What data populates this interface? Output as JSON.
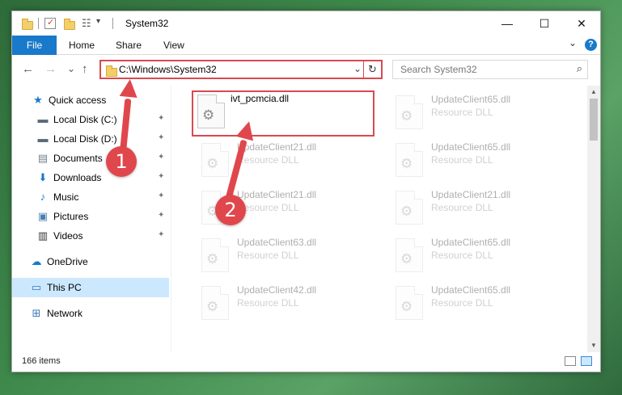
{
  "window": {
    "title": "System32",
    "controls": {
      "minimize": "—",
      "maximize": "☐",
      "close": "✕"
    }
  },
  "ribbon": {
    "tabs": [
      "File",
      "Home",
      "Share",
      "View"
    ],
    "expand_glyph": "⌄",
    "help_glyph": "?"
  },
  "nav": {
    "back": "←",
    "forward": "→",
    "recent": "⌄",
    "up": "↑",
    "address": "C:\\Windows\\System32",
    "address_dropdown": "⌄",
    "refresh": "↻",
    "search_placeholder": "Search System32",
    "search_glyph": "⌕"
  },
  "sidebar": {
    "items": [
      {
        "label": "Quick access",
        "icon": "star-icon",
        "glyph": "★",
        "color": "#1979ca",
        "pinned": false
      },
      {
        "label": "Local Disk (C:)",
        "icon": "drive-icon",
        "glyph": "▬",
        "color": "#5a6a7a",
        "pinned": true
      },
      {
        "label": "Local Disk (D:)",
        "icon": "drive-icon",
        "glyph": "▬",
        "color": "#5a6a7a",
        "pinned": true
      },
      {
        "label": "Documents",
        "icon": "documents-icon",
        "glyph": "▤",
        "color": "#6f7f8f",
        "pinned": true
      },
      {
        "label": "Downloads",
        "icon": "downloads-icon",
        "glyph": "⬇",
        "color": "#1979ca",
        "pinned": true
      },
      {
        "label": "Music",
        "icon": "music-icon",
        "glyph": "♪",
        "color": "#1979ca",
        "pinned": true
      },
      {
        "label": "Pictures",
        "icon": "pictures-icon",
        "glyph": "▣",
        "color": "#4a7fb0",
        "pinned": true
      },
      {
        "label": "Videos",
        "icon": "videos-icon",
        "glyph": "▥",
        "color": "#333333",
        "pinned": true
      },
      {
        "label": "OneDrive",
        "icon": "cloud-icon",
        "glyph": "☁",
        "color": "#1979ca",
        "pinned": false
      },
      {
        "label": "This PC",
        "icon": "computer-icon",
        "glyph": "▭",
        "color": "#3a78b8",
        "pinned": false
      },
      {
        "label": "Network",
        "icon": "network-icon",
        "glyph": "⊞",
        "color": "#3a78b8",
        "pinned": false
      }
    ],
    "pin_glyph": "📌"
  },
  "files": [
    {
      "name": "ivt_pcmcia.dll",
      "type": "",
      "faded": false,
      "highlight": true
    },
    {
      "name": "UpdateClient65.dll",
      "type": "Resource DLL",
      "faded": true
    },
    {
      "name": "UpdateClient21.dll",
      "type": "Resource DLL",
      "faded": true
    },
    {
      "name": "UpdateClient65.dll",
      "type": "Resource DLL",
      "faded": true
    },
    {
      "name": "UpdateClient21.dll",
      "type": "Resource DLL",
      "faded": true
    },
    {
      "name": "UpdateClient21.dll",
      "type": "Resource DLL",
      "faded": true
    },
    {
      "name": "UpdateClient63.dll",
      "type": "Resource DLL",
      "faded": true
    },
    {
      "name": "UpdateClient65.dll",
      "type": "Resource DLL",
      "faded": true
    },
    {
      "name": "UpdateClient42.dll",
      "type": "Resource DLL",
      "faded": true
    },
    {
      "name": "UpdateClient65.dll",
      "type": "Resource DLL",
      "faded": true
    }
  ],
  "status": {
    "item_count": "166 items"
  },
  "annotations": {
    "step1": "1",
    "step2": "2",
    "color": "#e0474c"
  },
  "colors": {
    "accent": "#1979ca",
    "highlight": "#d84a4f",
    "selected": "#cce8ff"
  }
}
